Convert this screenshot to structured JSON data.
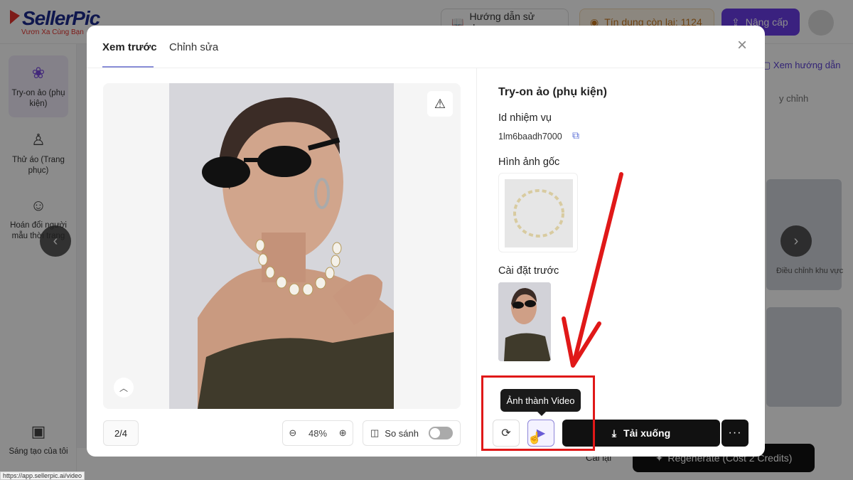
{
  "app": {
    "logo": "SellerPic",
    "logo_tagline": "Vươn Xa Cùng Bạn",
    "guide_label": "Hướng dẫn sử dụng",
    "credit_label": "Tín dụng còn lại: 1124",
    "upgrade_label": "Nâng cấp",
    "status_url": "https://app.sellerpic.ai/video"
  },
  "sidebar": {
    "items": [
      {
        "label": "Try-on ảo (phụ kiện)",
        "icon": "accessory-icon"
      },
      {
        "label": "Thử áo (Trang phục)",
        "icon": "outfit-icon"
      },
      {
        "label": "Hoán đổi người mẫu thời trang",
        "icon": "model-swap-icon"
      },
      {
        "label": "Sáng tạo của tôi",
        "icon": "creations-icon"
      }
    ]
  },
  "background_panel": {
    "guide_link": "Xem hướng dẫn",
    "sub_label": "y chỉnh",
    "adjust_label": "Điều chỉnh khu vực",
    "regenerate_label": "Regenerate (Cost 2 Credits)",
    "call_ai": "Cài lại"
  },
  "modal": {
    "tabs": [
      {
        "label": "Xem trước",
        "active": true
      },
      {
        "label": "Chỉnh sửa",
        "active": false
      }
    ],
    "page_indicator": "2/4",
    "zoom_level": "48%",
    "compare_label": "So sánh",
    "compare_on": false,
    "info": {
      "title": "Try-on ảo (phụ kiện)",
      "task_id_label": "Id nhiệm vụ",
      "task_id": "1lm6baadh7000",
      "original_label": "Hình ảnh gốc",
      "preset_label": "Cài đặt trước"
    },
    "tooltip": "Ảnh thành Video",
    "download_label": "Tải xuống",
    "more_label": "···"
  },
  "colors": {
    "accent": "#6a3de8",
    "annotation": "#e01818",
    "primary_button": "#111111"
  }
}
